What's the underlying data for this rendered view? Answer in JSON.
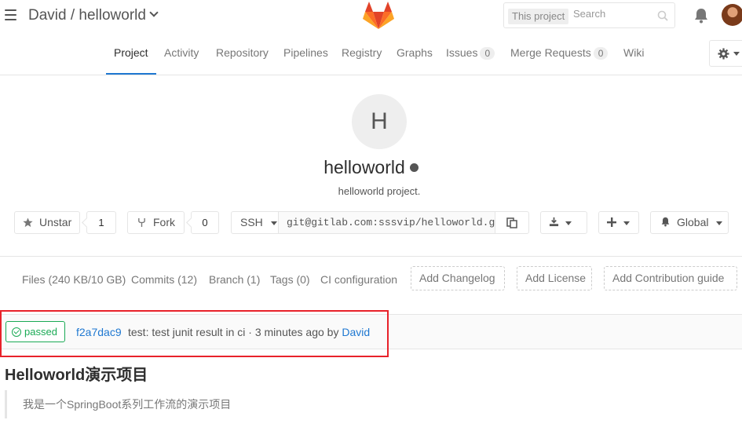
{
  "topbar": {
    "breadcrumb": "David / helloworld",
    "search_scope": "This project",
    "search_placeholder": "Search"
  },
  "nav": {
    "items": [
      {
        "label": "Project"
      },
      {
        "label": "Activity"
      },
      {
        "label": "Repository"
      },
      {
        "label": "Pipelines"
      },
      {
        "label": "Registry"
      },
      {
        "label": "Graphs"
      },
      {
        "label": "Issues",
        "count": "0"
      },
      {
        "label": "Merge Requests",
        "count": "0"
      },
      {
        "label": "Wiki"
      }
    ]
  },
  "project": {
    "avatar_letter": "H",
    "name": "helloworld",
    "description": "helloworld project."
  },
  "actions": {
    "star_label": "Unstar",
    "star_count": "1",
    "fork_label": "Fork",
    "fork_count": "0",
    "clone_protocol": "SSH",
    "clone_url": "git@gitlab.com:sssvip/helloworld.git",
    "notification_label": "Global"
  },
  "files": {
    "files": "Files (240 KB/10 GB)",
    "commits": "Commits (12)",
    "branch": "Branch (1)",
    "tags": "Tags (0)",
    "ci": "CI configuration",
    "add_changelog": "Add Changelog",
    "add_license": "Add License",
    "add_contribution": "Add Contribution guide"
  },
  "commit": {
    "status": "passed",
    "sha": "f2a7dac9",
    "message": "test: test junit result in ci · 3 minutes ago by ",
    "author": "David",
    "status_color": "#1aaa55"
  },
  "readme": {
    "title": "Helloworld演示项目",
    "quote": "我是一个SpringBoot系列工作流的演示项目"
  },
  "colors": {
    "link": "#1f78d1",
    "highlight_box": "#e8222a"
  }
}
